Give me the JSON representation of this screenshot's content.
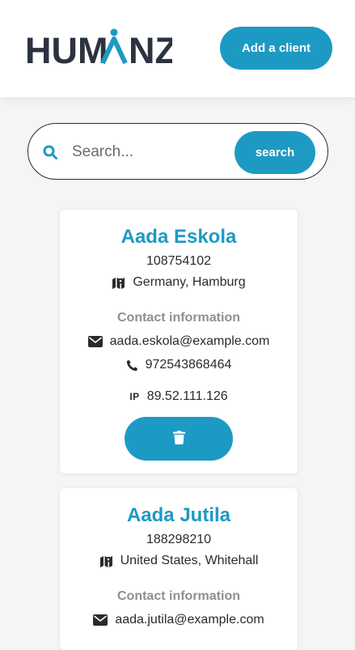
{
  "header": {
    "logo_text": "HUMANZ",
    "add_client_label": "Add a client"
  },
  "search": {
    "placeholder": "Search...",
    "value": "",
    "button_label": "search"
  },
  "clients": [
    {
      "name": "Aada Eskola",
      "id": "108754102",
      "location": "Germany, Hamburg",
      "contact_title": "Contact information",
      "email": "aada.eskola@example.com",
      "phone": "972543868464",
      "ip_label": "IP",
      "ip": "89.52.111.126"
    },
    {
      "name": "Aada Jutila",
      "id": "188298210",
      "location": "United States, Whitehall",
      "contact_title": "Contact information",
      "email": "aada.jutila@example.com"
    }
  ],
  "icons": {
    "search": "search-icon",
    "location": "map-icon",
    "email": "envelope-icon",
    "phone": "phone-icon",
    "delete": "trash-icon"
  },
  "colors": {
    "accent": "#1d9ac3",
    "logo_dark": "#2c3340",
    "muted": "#8f8f8f",
    "background": "#f5f5f5"
  }
}
